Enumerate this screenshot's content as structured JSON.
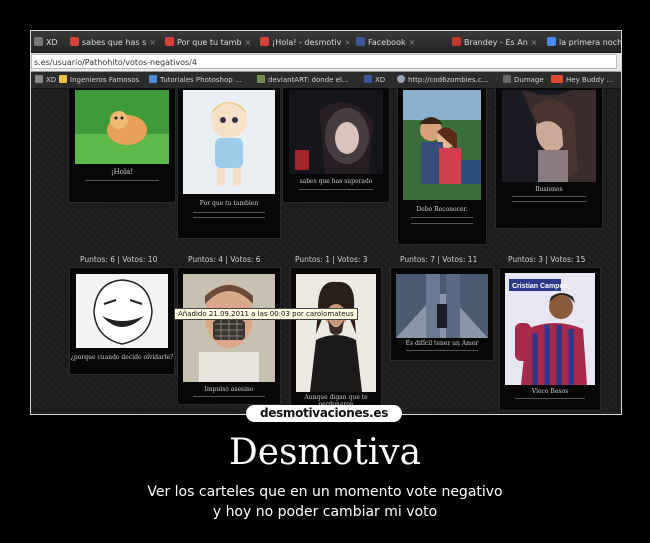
{
  "browser": {
    "tabs": [
      {
        "label": "XD",
        "favicon": "page-icon",
        "color": "#777777"
      },
      {
        "label": "sabes que has s",
        "favicon": "desmotivaciones-icon",
        "color": "#d6423a"
      },
      {
        "label": "Por que tu tamb",
        "favicon": "desmotivaciones-icon",
        "color": "#d6423a"
      },
      {
        "label": "¡Hola! - desmotiv",
        "favicon": "desmotivaciones-icon",
        "color": "#d6423a"
      },
      {
        "label": "Facebook",
        "favicon": "facebook-icon",
        "color": "#3b5998"
      },
      {
        "label": "Brandey - Es An",
        "favicon": "gmail-icon",
        "color": "#c0392b"
      },
      {
        "label": "la primera noche",
        "favicon": "google-icon",
        "color": "#4a8af4"
      }
    ],
    "url": "s.es/usuario/Pathohito/votos-negativos/4",
    "bookmarks": [
      {
        "label": "XD",
        "icon": "page-icon",
        "color": "#888888"
      },
      {
        "label": "Ingenieros Famosos",
        "icon": "folder-icon",
        "color": "#e8c04a"
      },
      {
        "label": "Tutoriales Photoshop ...",
        "icon": "bookmark-icon",
        "color": "#4a8ad6"
      },
      {
        "label": "deviantART: donde el...",
        "icon": "deviantart-icon",
        "color": "#6f8f4e"
      },
      {
        "label": "XD",
        "icon": "facebook-icon",
        "color": "#3b5998"
      },
      {
        "label": "http://cod6zombies.c...",
        "icon": "globe-icon",
        "color": "#9aa4b0"
      },
      {
        "label": "Dumage",
        "icon": "page-icon",
        "color": "#666666"
      },
      {
        "label": "Hey Buddy ...",
        "icon": "lol-icon",
        "color": "#d94a3a"
      }
    ]
  },
  "top_row": [
    {
      "caption": "¡Hola!"
    },
    {
      "caption": "Por que tu tambien"
    },
    {
      "caption": "sabes que has superado"
    },
    {
      "caption": "Debo Reconocer."
    },
    {
      "caption": "Ilusiones"
    }
  ],
  "bottom_row": [
    {
      "stats": "Puntos: 6 | Votos: 10",
      "caption": "¿porque cuando decido olvidarle?"
    },
    {
      "stats": "Puntos: 4 | Votos: 6",
      "caption": "Impulso asesino"
    },
    {
      "stats": "Puntos: 1 | Votos: 3",
      "caption": "Aunque digan que te perdonaron"
    },
    {
      "stats": "Puntos: 7 | Votos: 11",
      "caption": "Es difícil tener un Amor"
    },
    {
      "stats": "Puntos: 3 | Votos: 15",
      "caption": "Vieco Besos"
    }
  ],
  "tooltip": "Añadido 21.09.2011 a las 00:03 por carolomateus",
  "poster_name": "Cristian Campos",
  "logo": "desmotivaciones.es",
  "title": "Desmotiva",
  "caption_lines": [
    "Ver los carteles que en un momento vote negativo",
    "y hoy no poder cambiar mi voto"
  ]
}
